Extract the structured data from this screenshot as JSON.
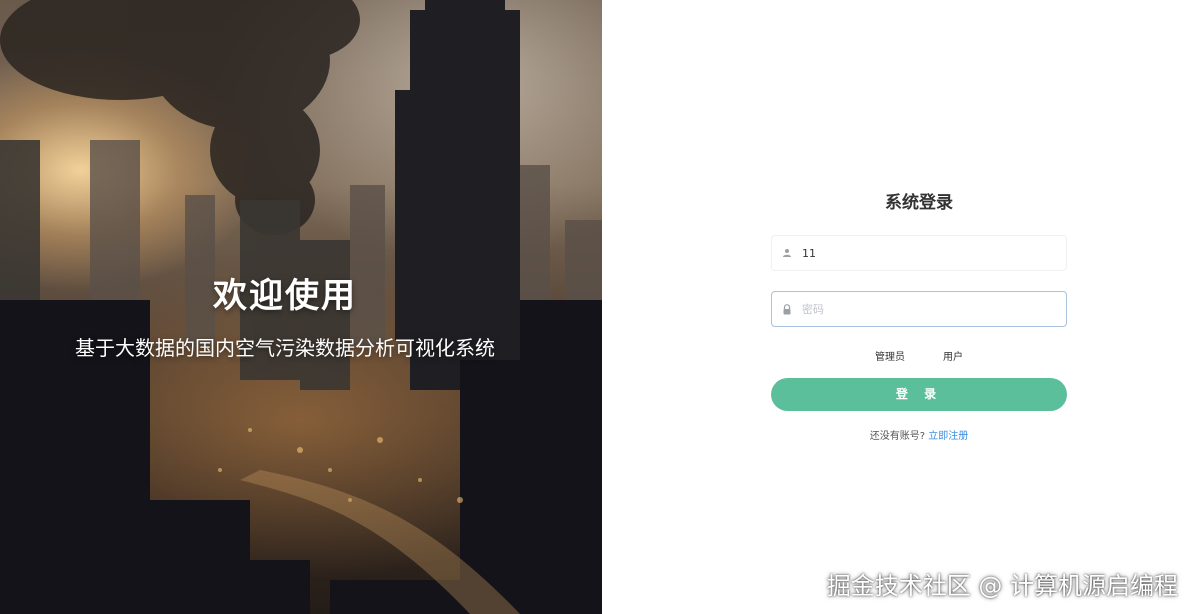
{
  "hero": {
    "title": "欢迎使用",
    "subtitle": "基于大数据的国内空气污染数据分析可视化系统"
  },
  "login": {
    "title": "系统登录",
    "username": {
      "value": "11",
      "icon": "user-icon"
    },
    "password": {
      "value": "",
      "placeholder": "密码",
      "icon": "lock-icon"
    },
    "roles": [
      "管理员",
      "用户"
    ],
    "submit_label": "登 录",
    "register_prompt": "还没有账号?",
    "register_link": "立即注册"
  },
  "colors": {
    "accent": "#5bbf9c",
    "link": "#3a8ee6",
    "focus_border": "#a9c2dd"
  },
  "watermark": "掘金技术社区 @ 计算机源启编程"
}
